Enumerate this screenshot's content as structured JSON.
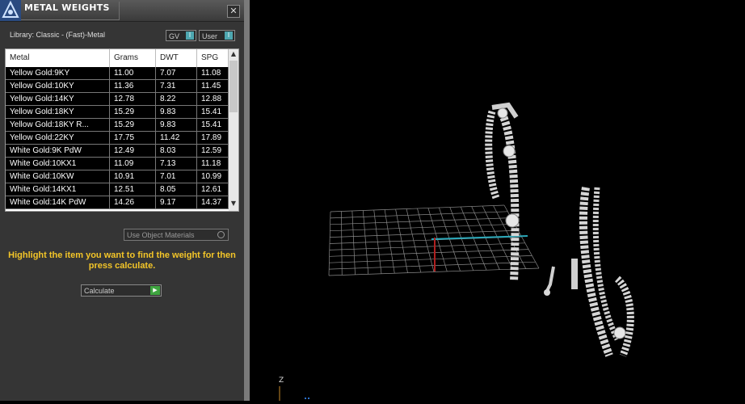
{
  "panel": {
    "title": "METAL WEIGHTS",
    "close_label": "✕",
    "library": "Library: Classic - (Fast)-Metal",
    "toggle_gv": "GV",
    "toggle_user": "User",
    "toggle_knob": "I",
    "use_object_materials": "Use Object Materials",
    "hint": "Highlight the item you want to find the weight for then press calculate.",
    "calculate_label": "Calculate"
  },
  "table": {
    "headers": [
      "Metal",
      "Grams",
      "DWT",
      "SPG"
    ],
    "rows": [
      [
        "Yellow Gold:9KY",
        "11.00",
        "7.07",
        "11.08"
      ],
      [
        "Yellow Gold:10KY",
        "11.36",
        "7.31",
        "11.45"
      ],
      [
        "Yellow Gold:14KY",
        "12.78",
        "8.22",
        "12.88"
      ],
      [
        "Yellow Gold:18KY",
        "15.29",
        "9.83",
        "15.41"
      ],
      [
        "Yellow Gold:18KY R...",
        "15.29",
        "9.83",
        "15.41"
      ],
      [
        "Yellow Gold:22KY",
        "17.75",
        "11.42",
        "17.89"
      ],
      [
        "White Gold:9K PdW",
        "12.49",
        "8.03",
        "12.59"
      ],
      [
        "White Gold:10KX1",
        "11.09",
        "7.13",
        "11.18"
      ],
      [
        "White Gold:10KW",
        "10.91",
        "7.01",
        "10.99"
      ],
      [
        "White Gold:14KX1",
        "12.51",
        "8.05",
        "12.61"
      ],
      [
        "White Gold:14K PdW",
        "14.26",
        "9.17",
        "14.37"
      ]
    ]
  },
  "viewport": {
    "axis_label": "Z",
    "grid_color": "#8a8a8a",
    "x_axis_color": "#2aa7b8",
    "y_axis_color": "#b02020",
    "model_color": "#d6d6d6"
  }
}
